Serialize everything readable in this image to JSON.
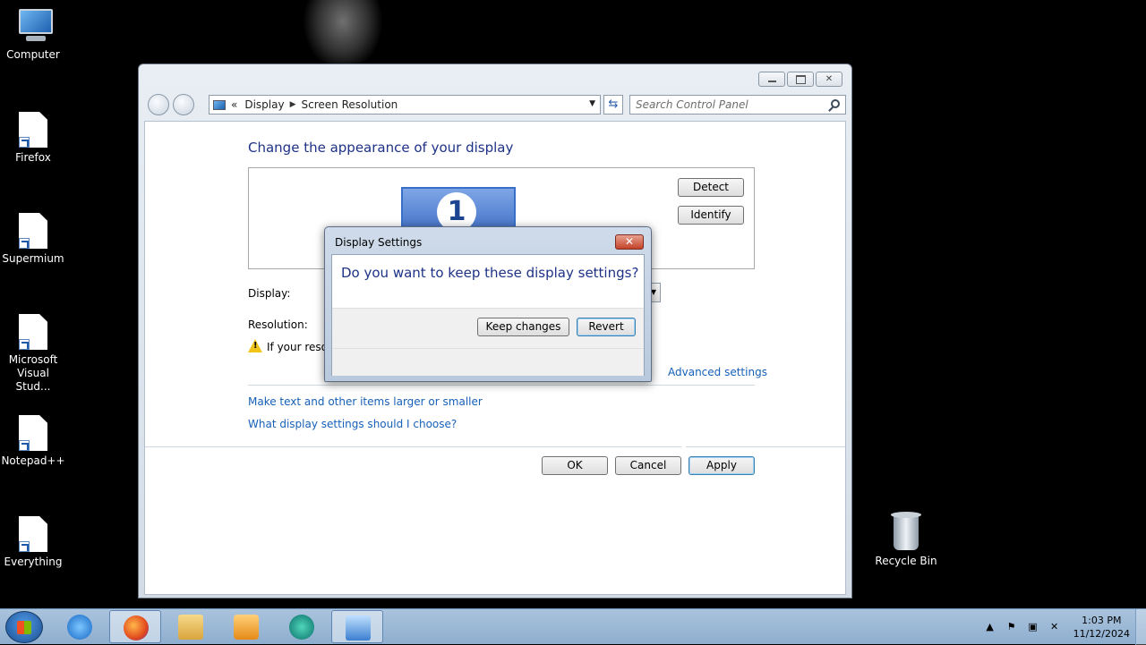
{
  "desktop": {
    "icons": [
      {
        "label": "Computer",
        "icon": "computer-icon"
      },
      {
        "label": "Firefox",
        "icon": "shortcut-file-icon"
      },
      {
        "label": "Supermium",
        "icon": "shortcut-file-icon"
      },
      {
        "label": "Microsoft Visual Stud...",
        "icon": "shortcut-file-icon"
      },
      {
        "label": "Notepad++",
        "icon": "shortcut-file-icon"
      },
      {
        "label": "Everything",
        "icon": "shortcut-file-icon"
      },
      {
        "label": "Recycle Bin",
        "icon": "recycle-bin-icon"
      }
    ]
  },
  "window": {
    "address": {
      "prefix": "«",
      "crumbs": [
        "Display",
        "Screen Resolution"
      ]
    },
    "search": {
      "placeholder": "Search Control Panel"
    },
    "heading": "Change the appearance of your display",
    "monitor_number": "1",
    "detect_label": "Detect",
    "identify_label": "Identify",
    "display_label": "Display:",
    "resolution_label": "Resolution:",
    "warning_text": "If your resolu",
    "advanced_link": "Advanced settings",
    "link_text_size": "Make text and other items larger or smaller",
    "link_which_settings": "What display settings should I choose?",
    "ok_label": "OK",
    "cancel_label": "Cancel",
    "apply_label": "Apply"
  },
  "dialog": {
    "title": "Display Settings",
    "close_glyph": "✕",
    "question": "Do you want to keep these display settings?",
    "keep_label": "Keep changes",
    "revert_label": "Revert"
  },
  "taskbar": {
    "apps": [
      "internet-explorer-icon",
      "firefox-icon",
      "file-explorer-icon",
      "media-player-icon",
      "browser-icon",
      "control-panel-icon"
    ],
    "time": "1:03 PM",
    "date": "11/12/2024"
  }
}
